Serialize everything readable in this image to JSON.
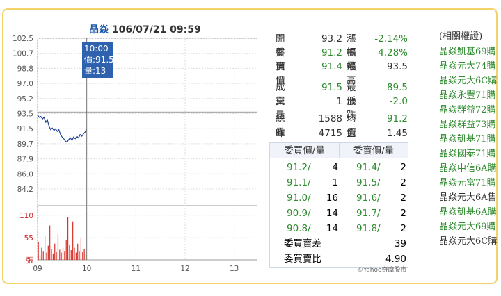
{
  "chart": {
    "title_name": "晶焱",
    "title_date": "106/07/21 09:59",
    "tooltip": {
      "time": "10:00",
      "price_label": "價:91.5",
      "vol_label": "量:13"
    }
  },
  "chart_data": {
    "type": "line",
    "title": "晶焱 106/07/21 09:59",
    "x_ticks": [
      "09",
      "10",
      "11",
      "12",
      "13"
    ],
    "y_ticks": [
      "102.5",
      "100.7",
      "98.8",
      "97.0",
      "95.2",
      "93.5",
      "91.5",
      "89.7",
      "87.9",
      "86.0",
      "84.2"
    ],
    "ylim": [
      84.2,
      102.5
    ],
    "reference_price": 93.5,
    "crosshair_time": "10:00",
    "price_series": {
      "x_minutes": [
        0,
        2,
        4,
        6,
        8,
        10,
        12,
        14,
        16,
        18,
        20,
        22,
        24,
        26,
        28,
        30,
        32,
        34,
        36,
        38,
        40,
        42,
        44,
        46,
        48,
        50,
        52,
        54,
        56,
        58,
        60
      ],
      "values": [
        93.2,
        92.9,
        93.0,
        92.7,
        92.9,
        92.3,
        92.6,
        91.8,
        91.4,
        91.6,
        91.3,
        91.5,
        91.2,
        91.4,
        90.8,
        90.5,
        90.3,
        90.0,
        89.9,
        90.2,
        90.4,
        90.1,
        90.5,
        90.3,
        90.6,
        90.4,
        90.8,
        90.6,
        90.9,
        91.1,
        91.5
      ]
    },
    "volume_ticks": [
      "110",
      "55",
      "張"
    ],
    "volume_ylim": [
      0,
      110
    ],
    "volume_series": {
      "x_minutes": [
        1,
        3,
        5,
        7,
        9,
        11,
        13,
        15,
        17,
        19,
        21,
        23,
        25,
        27,
        29,
        31,
        33,
        35,
        37,
        39,
        41,
        43,
        45,
        47,
        49,
        51,
        53,
        55,
        57,
        59
      ],
      "values": [
        45,
        12,
        30,
        22,
        60,
        18,
        35,
        85,
        26,
        15,
        40,
        20,
        64,
        25,
        18,
        30,
        22,
        50,
        105,
        38,
        24,
        95,
        30,
        18,
        40,
        22,
        55,
        20,
        26,
        13
      ]
    }
  },
  "quotes": {
    "open": {
      "label": "開盤",
      "value": "93.2"
    },
    "change_pct": {
      "label": "漲幅",
      "value": "-2.14%"
    },
    "bid": {
      "label": "買價",
      "value": "91.2"
    },
    "amplitude": {
      "label": "振幅",
      "value": "4.28%"
    },
    "ask": {
      "label": "賣價",
      "value": "91.4"
    },
    "high": {
      "label": "最高",
      "value": "93.5"
    },
    "last": {
      "label": "成交",
      "value": "91.5"
    },
    "low": {
      "label": "最低",
      "value": "89.5"
    },
    "tick_vol": {
      "label": "單量",
      "value": "1"
    },
    "change": {
      "label": "漲跌",
      "value": "-2.0"
    },
    "total_vol": {
      "label": "總量",
      "value": "1588"
    },
    "avg": {
      "label": "均價",
      "value": "91.2"
    },
    "prev_vol": {
      "label": "昨量",
      "value": "4715"
    },
    "amount": {
      "label": "金額",
      "value": "1.45"
    }
  },
  "orderbook": {
    "bid_header": "委買價/量",
    "ask_header": "委賣價/量",
    "rows": [
      {
        "bid": "91.2/",
        "bid_vol": "4",
        "ask": "91.4/",
        "ask_vol": "2"
      },
      {
        "bid": "91.1/",
        "bid_vol": "1",
        "ask": "91.5/",
        "ask_vol": "2"
      },
      {
        "bid": "91.0/",
        "bid_vol": "16",
        "ask": "91.6/",
        "ask_vol": "2"
      },
      {
        "bid": "90.9/",
        "bid_vol": "14",
        "ask": "91.7/",
        "ask_vol": "2"
      },
      {
        "bid": "90.8/",
        "bid_vol": "14",
        "ask": "91.8/",
        "ask_vol": "2"
      }
    ],
    "diff_label": "委買賣差",
    "diff_value": "39",
    "ratio_label": "委買賣比",
    "ratio_value": "4.90"
  },
  "copyright": "©Yahoo奇摩股市",
  "related": {
    "title": "(相關權證)",
    "links": [
      "晶焱凱基69購",
      "晶焱元大74購",
      "晶焱元大6C購",
      "晶焱永豐71購",
      "晶焱群益72購",
      "晶焱群益73購",
      "晶焱凱基71購",
      "晶焱國泰71購",
      "晶焱中信6A購",
      "晶焱元富71購",
      "晶焱元大6A售",
      "晶焱凱基6A購",
      "晶焱元大69購",
      "晶焱元大6C購"
    ]
  },
  "colors": {
    "price_line": "#1a3d8f",
    "volume_bar": "#d8312a",
    "frame": "#f4d26a",
    "tooltip_bg": "#2f62ae",
    "green": "#2e8b2e",
    "red": "#c62828"
  }
}
